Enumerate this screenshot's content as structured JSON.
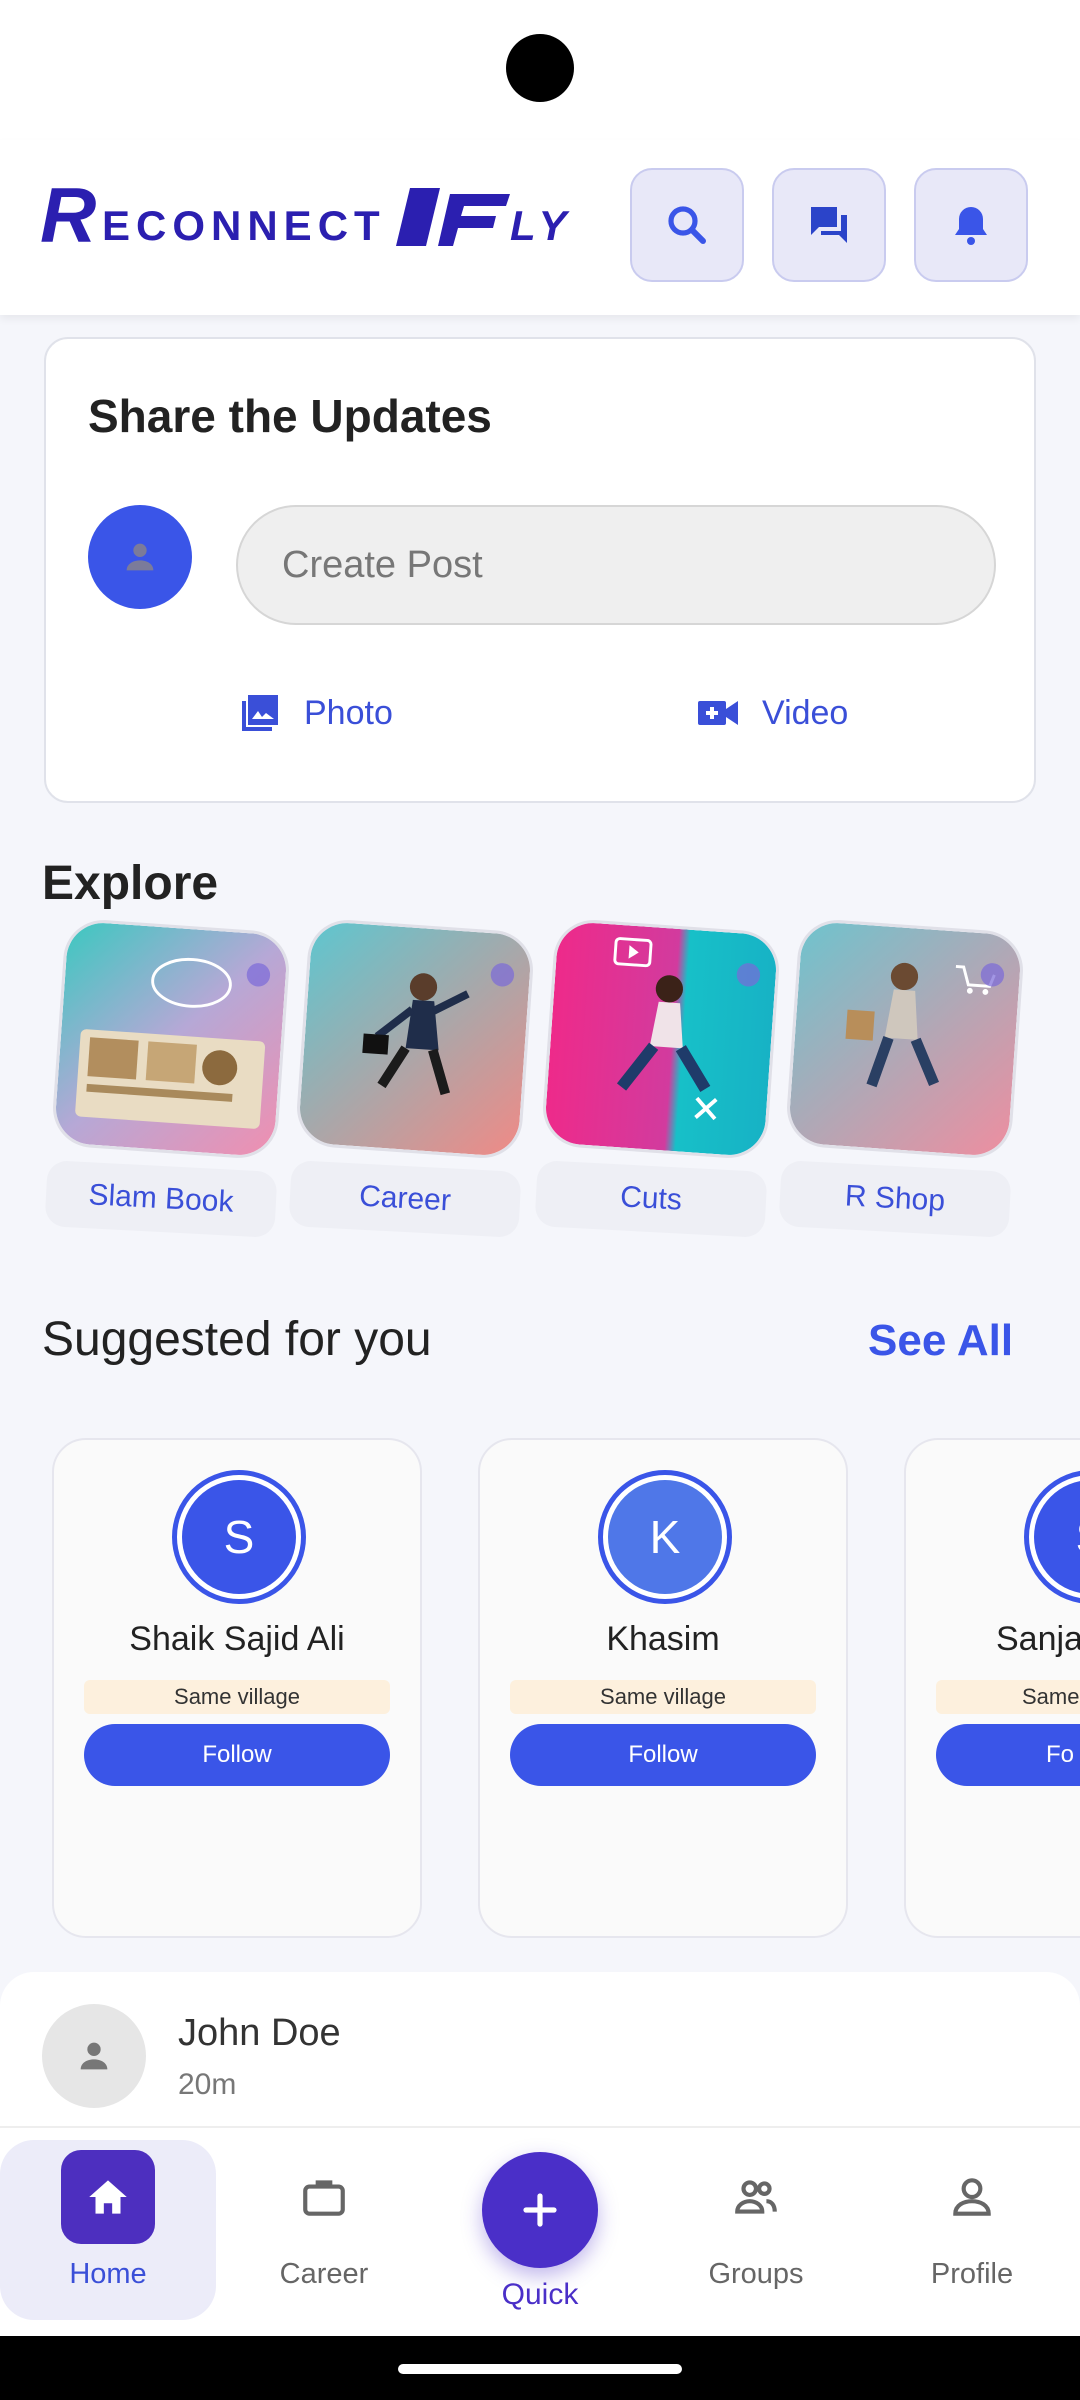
{
  "header": {
    "logo_text": "RECONNECT FLY",
    "buttons": [
      {
        "name": "search-icon"
      },
      {
        "name": "chat-icon"
      },
      {
        "name": "bell-icon"
      }
    ]
  },
  "share": {
    "title": "Share the Updates",
    "create_post_placeholder": "Create Post",
    "photo_label": "Photo",
    "video_label": "Video"
  },
  "explore": {
    "title": "Explore",
    "items": [
      {
        "label": "Slam Book"
      },
      {
        "label": "Career"
      },
      {
        "label": "Cuts"
      },
      {
        "label": "R Shop"
      }
    ]
  },
  "suggested": {
    "title": "Suggested for you",
    "see_all": "See All",
    "users": [
      {
        "initial": "S",
        "name": "Shaik Sajid Ali",
        "relation": "Same village",
        "button": "Follow"
      },
      {
        "initial": "K",
        "name": "Khasim",
        "relation": "Same village",
        "button": "Follow"
      },
      {
        "initial": "S",
        "name": "Sanja",
        "relation": "Same",
        "button": "Fo"
      }
    ]
  },
  "post": {
    "author": "John Doe",
    "time": "20m"
  },
  "nav": {
    "home": "Home",
    "career": "Career",
    "quick": "Quick",
    "groups": "Groups",
    "profile": "Profile"
  },
  "colors": {
    "accent": "#3a55e8",
    "primary_purple": "#4a2fc8",
    "tag_bg": "#fdf0dd"
  }
}
